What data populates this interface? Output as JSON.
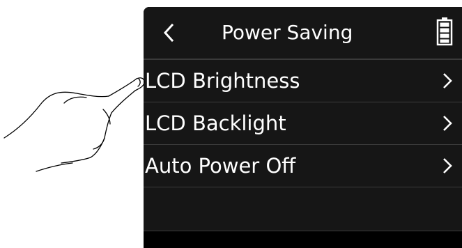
{
  "header": {
    "title": "Power Saving",
    "back_icon": "chevron-left-icon",
    "battery_icon": "battery-icon"
  },
  "menu": {
    "items": [
      {
        "label": "LCD Brightness",
        "icon": "chevron-right-icon"
      },
      {
        "label": "LCD Backlight",
        "icon": "chevron-right-icon"
      },
      {
        "label": "Auto Power Off",
        "icon": "chevron-right-icon"
      }
    ]
  },
  "illustration": {
    "icon": "pointing-hand-icon"
  },
  "colors": {
    "screen_background": "#000000",
    "panel_background": "#161616",
    "divider": "#3c3c3c",
    "text": "#ffffff"
  }
}
